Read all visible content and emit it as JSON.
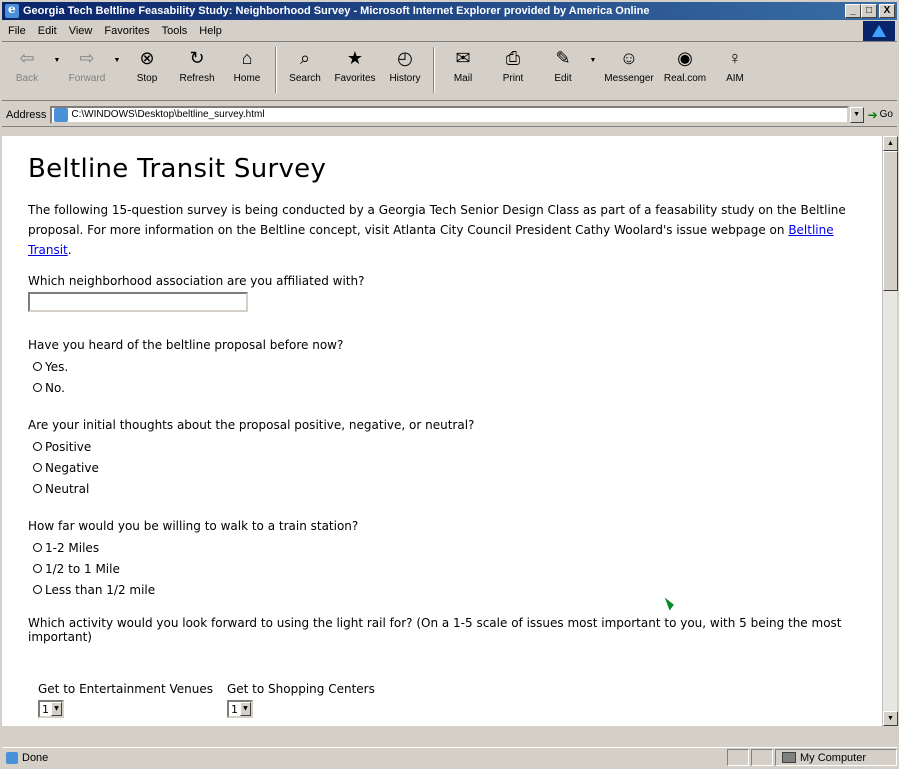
{
  "window": {
    "title": "Georgia Tech Beltline Feasability Study: Neighborhood Survey - Microsoft Internet Explorer provided by America Online",
    "controls": [
      "_",
      "□",
      "X"
    ]
  },
  "menu": {
    "items": [
      "File",
      "Edit",
      "View",
      "Favorites",
      "Tools",
      "Help"
    ]
  },
  "toolbar": {
    "buttons": [
      {
        "label": "Back",
        "icon": "back-arrow-icon",
        "glyph": "⇦"
      },
      {
        "label": "Forward",
        "icon": "forward-arrow-icon",
        "glyph": "⇨"
      },
      {
        "label": "Stop",
        "icon": "stop-icon",
        "glyph": "⊗"
      },
      {
        "label": "Refresh",
        "icon": "refresh-icon",
        "glyph": "↻"
      },
      {
        "label": "Home",
        "icon": "home-icon",
        "glyph": "⌂"
      },
      {
        "label": "Search",
        "icon": "search-icon",
        "glyph": "⌕"
      },
      {
        "label": "Favorites",
        "icon": "favorites-icon",
        "glyph": "★"
      },
      {
        "label": "History",
        "icon": "history-icon",
        "glyph": "◴"
      },
      {
        "label": "Mail",
        "icon": "mail-icon",
        "glyph": "✉"
      },
      {
        "label": "Print",
        "icon": "print-icon",
        "glyph": "⎙"
      },
      {
        "label": "Edit",
        "icon": "edit-icon",
        "glyph": "✎"
      },
      {
        "label": "Messenger",
        "icon": "messenger-icon",
        "glyph": "☺"
      },
      {
        "label": "Real.com",
        "icon": "real-icon",
        "glyph": "◉"
      },
      {
        "label": "AIM",
        "icon": "aim-icon",
        "glyph": "♀"
      }
    ]
  },
  "address": {
    "label": "Address",
    "url": "C:\\WINDOWS\\Desktop\\beltline_survey.html",
    "go_label": "Go"
  },
  "page": {
    "heading": "Beltline Transit Survey",
    "intro_text": "The following 15-question survey is being conducted by a Georgia Tech Senior Design Class as part of a feasability study on the Beltline proposal. For more information on the Beltline concept, visit Atlanta City Council President Cathy Woolard's issue webpage on ",
    "intro_link": "Beltline Transit",
    "intro_end": ".",
    "q1": {
      "text": "Which neighborhood association are you affiliated with?",
      "value": ""
    },
    "q2": {
      "text": "Have you heard of the beltline proposal before now?",
      "options": [
        "Yes.",
        "No."
      ]
    },
    "q3": {
      "text": "Are your initial thoughts about the proposal positive, negative, or neutral?",
      "options": [
        "Positive",
        "Negative",
        "Neutral"
      ]
    },
    "q4": {
      "text": "How far would you be willing to walk to a train station?",
      "options": [
        "1-2 Miles",
        "1/2 to 1 Mile",
        "Less than 1/2 mile"
      ]
    },
    "q5": {
      "text": "Which activity would you look forward to using the light rail for? (On a 1-5 scale of issues most important to you, with 5 being the most important)",
      "items": [
        {
          "label": "Get to Entertainment Venues",
          "value": "1"
        },
        {
          "label": "Get to Shopping Centers",
          "value": "1"
        }
      ]
    }
  },
  "status": {
    "text": "Done",
    "zone": "My Computer"
  }
}
